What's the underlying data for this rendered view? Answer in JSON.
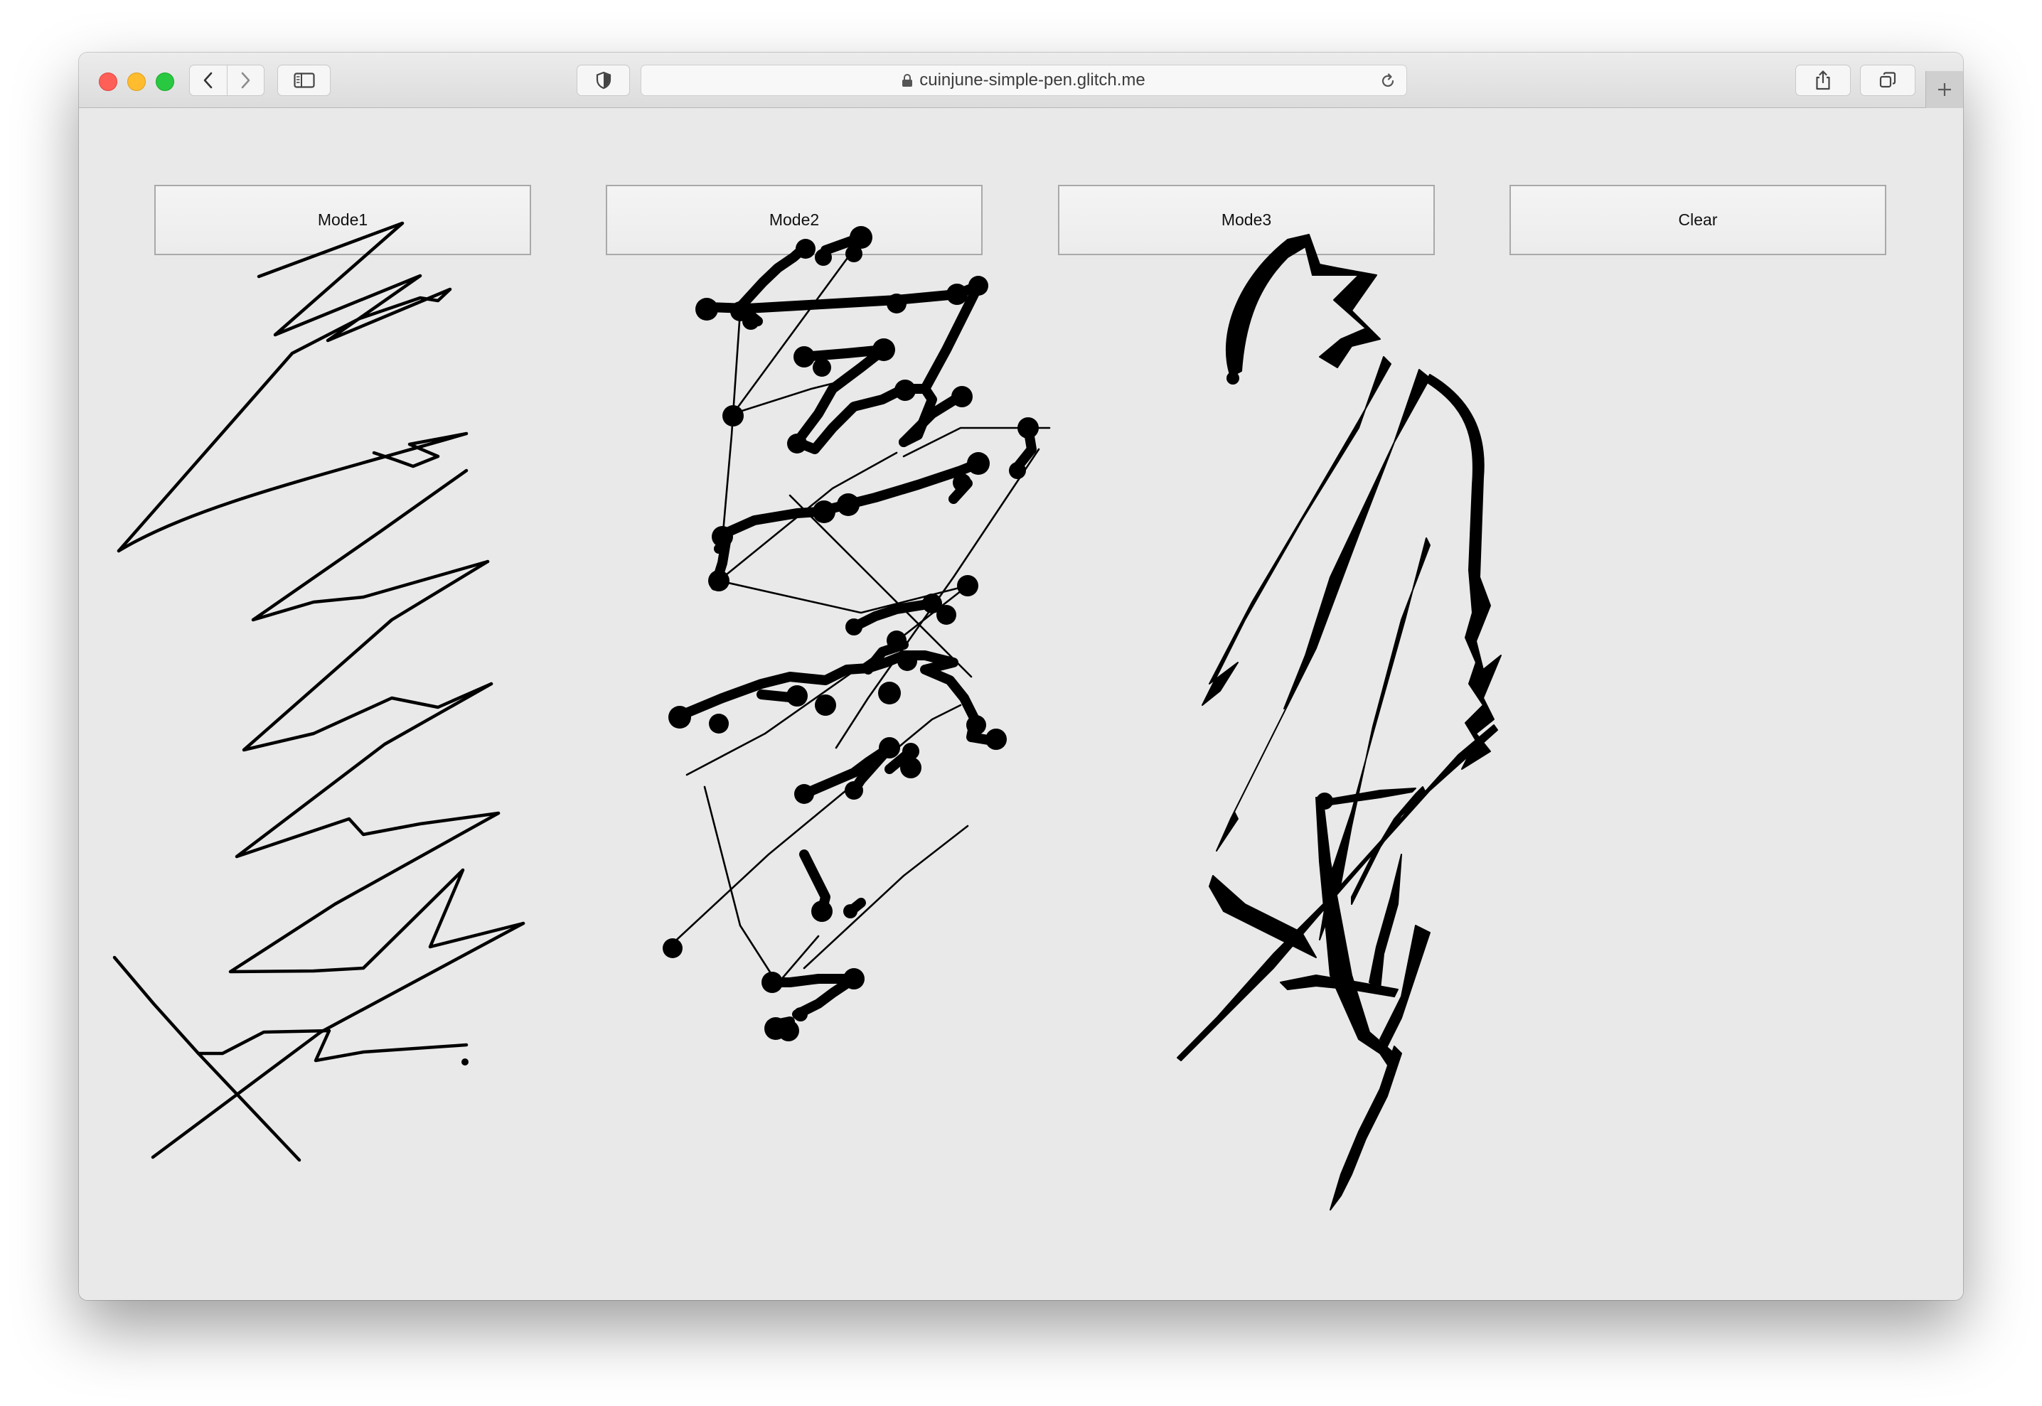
{
  "browser": {
    "url": "cuinjune-simple-pen.glitch.me"
  },
  "buttons": {
    "mode1": "Mode1",
    "mode2": "Mode2",
    "mode3": "Mode3",
    "clear": "Clear"
  }
}
